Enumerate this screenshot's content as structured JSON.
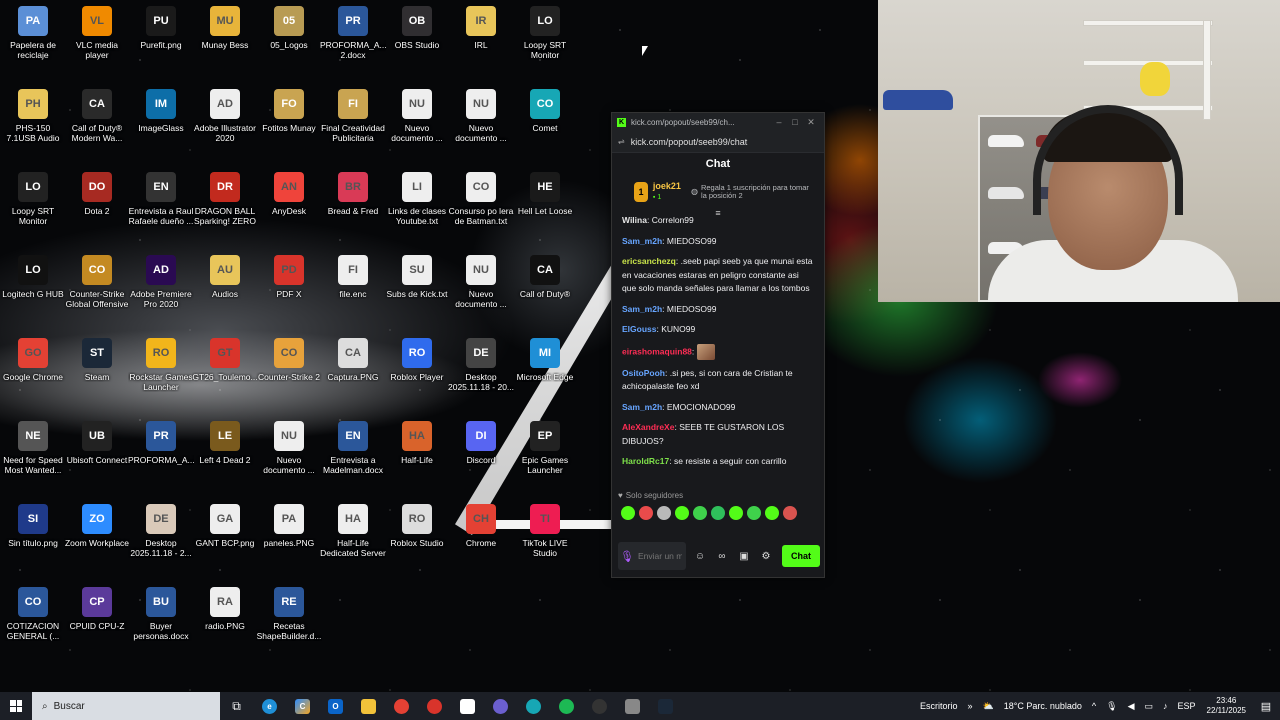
{
  "desktop_icons": [
    {
      "label": "Papelera de reciclaje",
      "icon": "recycle-bin-icon",
      "color": "#5b8fd6"
    },
    {
      "label": "VLC media player",
      "icon": "vlc-icon",
      "color": "#f08a00"
    },
    {
      "label": "Purefit.png",
      "icon": "image-file-icon",
      "color": "#1a1a1a"
    },
    {
      "label": "Munay Bess",
      "icon": "folder-icon",
      "color": "#e8b43a"
    },
    {
      "label": "05_Logos",
      "icon": "folder-icon",
      "color": "#b89b53"
    },
    {
      "label": "PROFORMA_A...VITAIN 2.docx",
      "icon": "word-doc-icon",
      "color": "#2b579a"
    },
    {
      "label": "OBS Studio",
      "icon": "obs-icon",
      "color": "#302e31"
    },
    {
      "label": "IRL",
      "icon": "folder-icon",
      "color": "#e8c55a"
    },
    {
      "label": "Loopy SRT Monitor",
      "icon": "srt-monitor-icon",
      "color": "#222222"
    },
    {
      "label": "PHS-150 7.1USB Audio Setup",
      "icon": "folder-icon",
      "color": "#e8c55a"
    },
    {
      "label": "Call of Duty® Modern Wa...",
      "icon": "cod-mw-icon",
      "color": "#2a2a2a"
    },
    {
      "label": "ImageGlass",
      "icon": "imageglass-icon",
      "color": "#0d6ea8"
    },
    {
      "label": "Adobe Illustrator 2020",
      "icon": "blank-file-icon",
      "color": "#eeeeee"
    },
    {
      "label": "Fotitos Munay",
      "icon": "folder-icon",
      "color": "#c9a451"
    },
    {
      "label": "Final Creatividad Publicitaria",
      "icon": "folder-icon",
      "color": "#c9a451"
    },
    {
      "label": "Nuevo documento ...",
      "icon": "text-file-icon",
      "color": "#eeeeee"
    },
    {
      "label": "Nuevo documento ...",
      "icon": "text-file-icon",
      "color": "#eeeeee"
    },
    {
      "label": "Comet",
      "icon": "comet-icon",
      "color": "#17a7b5"
    },
    {
      "label": "Loopy SRT Monitor",
      "icon": "srt-monitor-icon",
      "color": "#222222"
    },
    {
      "label": "Dota 2",
      "icon": "dota-icon",
      "color": "#a72a22"
    },
    {
      "label": "Entrevista a Raul Rafaele dueño ...",
      "icon": "video-file-icon",
      "color": "#333333"
    },
    {
      "label": "DRAGON BALL Sparking! ZERO",
      "icon": "dragonball-icon",
      "color": "#c22a1e"
    },
    {
      "label": "AnyDesk",
      "icon": "anydesk-icon",
      "color": "#ef443b"
    },
    {
      "label": "Bread & Fred",
      "icon": "game-icon",
      "color": "#d93a56"
    },
    {
      "label": "Links de clases Youtube.txt",
      "icon": "text-file-icon",
      "color": "#eeeeee"
    },
    {
      "label": "Consurso po lera de Batman.txt",
      "icon": "text-file-icon",
      "color": "#eeeeee"
    },
    {
      "label": "Hell Let Loose",
      "icon": "hell-let-loose-icon",
      "color": "#1a1a1a"
    },
    {
      "label": "Logitech G HUB",
      "icon": "logitech-icon",
      "color": "#111111"
    },
    {
      "label": "Counter-Strike Global Offensive",
      "icon": "csgo-icon",
      "color": "#c48a22"
    },
    {
      "label": "Adobe Premiere Pro 2020",
      "icon": "premiere-icon",
      "color": "#2a0a52"
    },
    {
      "label": "Audios",
      "icon": "folder-icon",
      "color": "#e8c55a"
    },
    {
      "label": "PDF X",
      "icon": "pdfx-icon",
      "color": "#d9342b"
    },
    {
      "label": "file.enc",
      "icon": "blank-file-icon",
      "color": "#eeeeee"
    },
    {
      "label": "Subs de Kick.txt",
      "icon": "text-file-icon",
      "color": "#eeeeee"
    },
    {
      "label": "Nuevo documento ...",
      "icon": "text-file-icon",
      "color": "#eeeeee"
    },
    {
      "label": "Call of Duty®",
      "icon": "cod-icon",
      "color": "#111111"
    },
    {
      "label": "Google Chrome",
      "icon": "chrome-icon",
      "color": "#e44134"
    },
    {
      "label": "Steam",
      "icon": "steam-icon",
      "color": "#1b2838"
    },
    {
      "label": "Rockstar Games Launcher",
      "icon": "rockstar-icon",
      "color": "#f2b51b"
    },
    {
      "label": "GT26_Toulemo...",
      "icon": "pdf-file-icon",
      "color": "#d9342b"
    },
    {
      "label": "Counter-Strike 2",
      "icon": "cs2-icon",
      "color": "#e7a23b"
    },
    {
      "label": "Captura.PNG",
      "icon": "image-file-icon",
      "color": "#dddddd"
    },
    {
      "label": "Roblox Player",
      "icon": "roblox-icon",
      "color": "#2f6bed"
    },
    {
      "label": "Desktop 2025.11.18 - 20...",
      "icon": "video-file-icon",
      "color": "#444444"
    },
    {
      "label": "Microsoft Edge",
      "icon": "edge-icon",
      "color": "#1f8fd6"
    },
    {
      "label": "Need for Speed Most Wanted...",
      "icon": "nfs-icon",
      "color": "#555555"
    },
    {
      "label": "Ubisoft Connect",
      "icon": "ubisoft-icon",
      "color": "#222222"
    },
    {
      "label": "PROFORMA_A...VITAIN.docx",
      "icon": "word-doc-icon",
      "color": "#2b579a"
    },
    {
      "label": "Left 4 Dead 2",
      "icon": "l4d2-icon",
      "color": "#7a5a1d"
    },
    {
      "label": "Nuevo documento ...",
      "icon": "text-file-icon",
      "color": "#eeeeee"
    },
    {
      "label": "Entrevista a Madelman.docx",
      "icon": "word-doc-icon",
      "color": "#2b579a"
    },
    {
      "label": "Half-Life",
      "icon": "half-life-icon",
      "color": "#d9632b"
    },
    {
      "label": "Discord",
      "icon": "discord-icon",
      "color": "#5865f2"
    },
    {
      "label": "Epic Games Launcher",
      "icon": "epic-icon",
      "color": "#222222"
    },
    {
      "label": "Sin título.png",
      "icon": "image-file-icon",
      "color": "#1f3a8a"
    },
    {
      "label": "Zoom Workplace",
      "icon": "zoom-icon",
      "color": "#2d8cff"
    },
    {
      "label": "Desktop 2025.11.18 - 2...",
      "icon": "video-file-icon",
      "color": "#d9c9b9"
    },
    {
      "label": "GANT BCP.png",
      "icon": "image-file-icon",
      "color": "#eeeeee"
    },
    {
      "label": "paneles.PNG",
      "icon": "image-file-icon",
      "color": "#eeeeee"
    },
    {
      "label": "Half-Life Dedicated Server",
      "icon": "blank-file-icon",
      "color": "#eeeeee"
    },
    {
      "label": "Roblox Studio",
      "icon": "roblox-studio-icon",
      "color": "#dddddd"
    },
    {
      "label": "Chrome",
      "icon": "chrome-icon",
      "color": "#e44134"
    },
    {
      "label": "TikTok LIVE Studio",
      "icon": "tiktok-icon",
      "color": "#ee1d52"
    },
    {
      "label": "COTIZACION GENERAL (...",
      "icon": "word-doc-icon",
      "color": "#2b579a"
    },
    {
      "label": "CPUID CPU-Z",
      "icon": "cpuz-icon",
      "color": "#5b3a9a"
    },
    {
      "label": "Buyer personas.docx",
      "icon": "word-doc-icon",
      "color": "#2b579a"
    },
    {
      "label": "radio.PNG",
      "icon": "image-file-icon",
      "color": "#eeeeee"
    },
    {
      "label": "Recetas ShapeBuilder.d...",
      "icon": "word-doc-icon",
      "color": "#2b579a"
    }
  ],
  "chat": {
    "window_title": "kick.com/popout/seeb99/ch...",
    "url": "kick.com/popout/seeb99/chat",
    "header": "Chat",
    "top_gifter": {
      "rank": "1",
      "name": "joek21",
      "count": "1"
    },
    "promo": "Regala 1 suscripción para tomar la posición 2",
    "messages": [
      {
        "user": "Wilina",
        "text": "Correlon99",
        "color": "#e6e6e6"
      },
      {
        "user": "Sam_m2h",
        "text": "MIEDOSO99",
        "color": "#67a5ff"
      },
      {
        "user": "ericsanchezq",
        "text": ".seeb papi seeb ya que munai esta en vacaciones estaras en peligro constante asi que solo manda señales para llamar a los tombos",
        "color": "#c8e34a"
      },
      {
        "user": "Sam_m2h",
        "text": "MIEDOSO99",
        "color": "#67a5ff"
      },
      {
        "user": "ElGouss",
        "text": "KUNO99",
        "color": "#67a5ff"
      },
      {
        "user": "eirashomaquin88",
        "text": "",
        "color": "#ff2d55"
      },
      {
        "user": "OsitoPooh",
        "text": ".si pes, si con cara de Cristian te achicopalaste feo xd",
        "color": "#67a5ff"
      },
      {
        "user": "Sam_m2h",
        "text": "EMOCIONADO99",
        "color": "#67a5ff"
      },
      {
        "user": "AleXandreXe",
        "text": "SEEB TE GUSTARON LOS DIBUJOS?",
        "color": "#ff2d55"
      },
      {
        "user": "HaroldRc17",
        "text": "se resiste a seguir con carrillo",
        "color": "#7ee04a"
      }
    ],
    "followers_mode": "Solo seguidores",
    "input_placeholder": "Enviar un mensaje",
    "send_label": "Chat",
    "accent": "#53fc18"
  },
  "taskbar": {
    "search_placeholder": "Buscar",
    "desktop_label": "Escritorio",
    "weather": "18°C  Parc. nublado",
    "language": "ESP",
    "time": "23:46",
    "date": "22/11/2025"
  }
}
